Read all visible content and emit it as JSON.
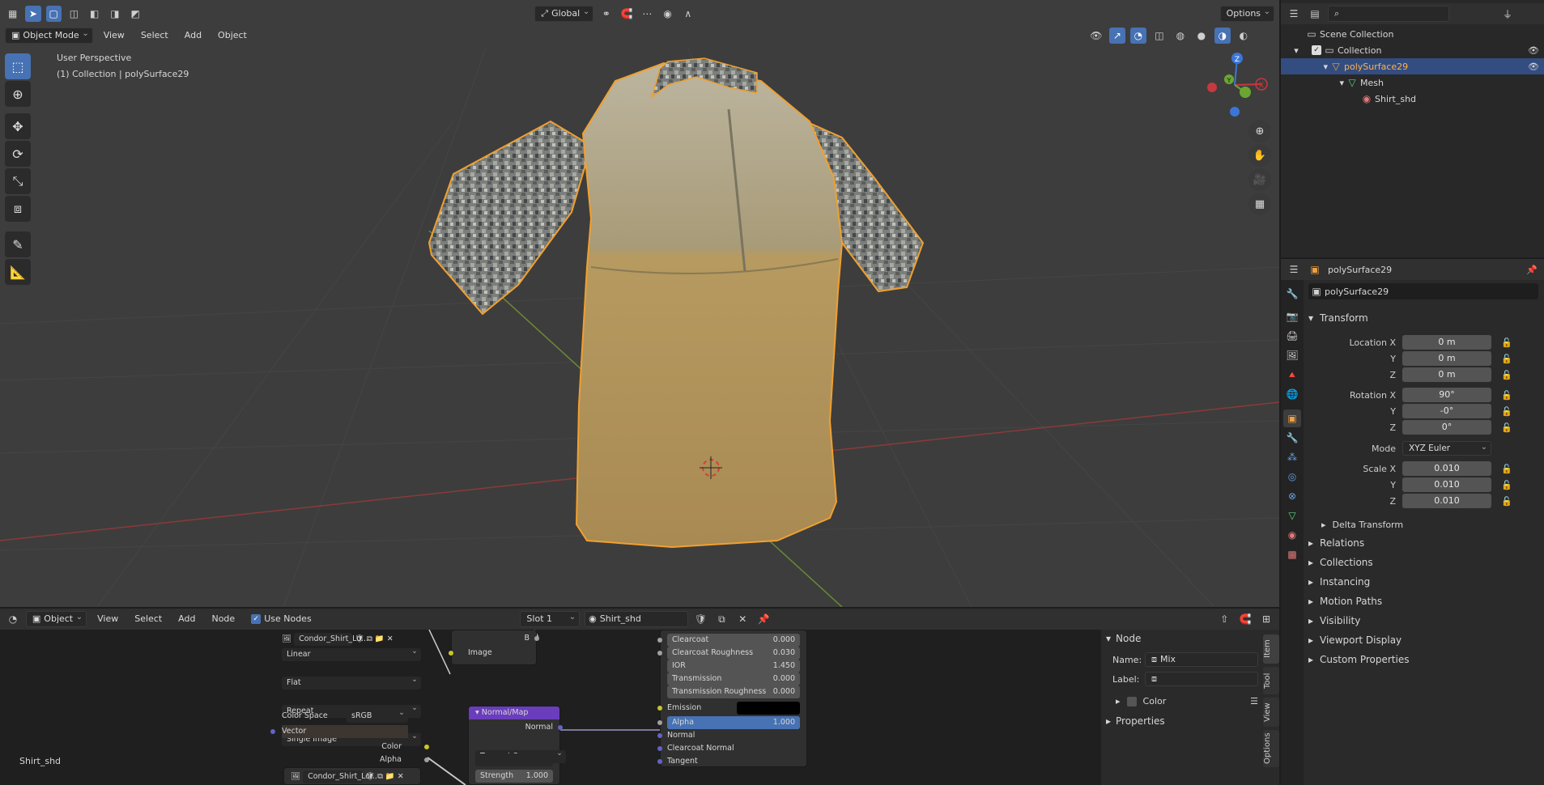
{
  "viewport": {
    "orientation": "Global",
    "options_label": "Options",
    "mode": "Object Mode",
    "menu": [
      "View",
      "Select",
      "Add",
      "Object"
    ],
    "perspective_text": "User Perspective",
    "collection_text": "(1) Collection | polySurface29",
    "gizmo_axes": [
      "Z",
      "Y",
      "X"
    ]
  },
  "outliner": {
    "rows": [
      "Scene Collection",
      "Collection",
      "polySurface29",
      "Mesh",
      "Shirt_shd"
    ]
  },
  "properties": {
    "header_object": "polySurface29",
    "name_field": "polySurface29",
    "transform_title": "Transform",
    "location_label": "Location X",
    "rotation_label": "Rotation X",
    "scale_label": "Scale X",
    "y_label": "Y",
    "z_label": "Z",
    "location": [
      "0 m",
      "0 m",
      "0 m"
    ],
    "rotation": [
      "90°",
      "-0°",
      "0°"
    ],
    "mode_label": "Mode",
    "mode_value": "XYZ Euler",
    "scale": [
      "0.010",
      "0.010",
      "0.010"
    ],
    "delta_transform": "Delta Transform",
    "panels": [
      "Relations",
      "Collections",
      "Instancing",
      "Motion Paths",
      "Visibility",
      "Viewport Display",
      "Custom Properties"
    ]
  },
  "node_editor": {
    "object_dd": "Object",
    "menu": [
      "View",
      "Select",
      "Add",
      "Node"
    ],
    "use_nodes": "Use Nodes",
    "slot": "Slot 1",
    "material": "Shirt_shd",
    "material_label": "Shirt_shd",
    "image_node": {
      "image_name": "Condor_Shirt_Lo...",
      "interpolation": "Linear",
      "projection": "Flat",
      "extension": "Repeat",
      "source": "Single Image",
      "color_space_label": "Color Space",
      "color_space_value": "sRGB",
      "vector": "Vector",
      "color_out": "Color",
      "alpha_out": "Alpha"
    },
    "image_node2": {
      "image_name": "Condor_Shirt_Lo..."
    },
    "sep_node": {
      "b": "B",
      "image": "Image"
    },
    "normal_map": {
      "title": "Normal/Map",
      "normal_out": "Normal",
      "space": "Tangent Space",
      "strength_label": "Strength",
      "strength_value": "1.000"
    },
    "bsdf": {
      "rows": [
        {
          "label": "Clearcoat",
          "value": "0.000"
        },
        {
          "label": "Clearcoat Roughness",
          "value": "0.030"
        },
        {
          "label": "IOR",
          "value": "1.450"
        },
        {
          "label": "Transmission",
          "value": "0.000"
        },
        {
          "label": "Transmission Roughness",
          "value": "0.000"
        }
      ],
      "emission": "Emission",
      "alpha_label": "Alpha",
      "alpha_value": "1.000",
      "normal": "Normal",
      "clearcoat_normal": "Clearcoat Normal",
      "tangent": "Tangent"
    },
    "sidebar": {
      "node_title": "Node",
      "name_label": "Name:",
      "name_value": "Mix",
      "label_label": "Label:",
      "color_label": "Color",
      "properties_label": "Properties",
      "tabs": [
        "Item",
        "Tool",
        "View",
        "Options"
      ]
    }
  }
}
